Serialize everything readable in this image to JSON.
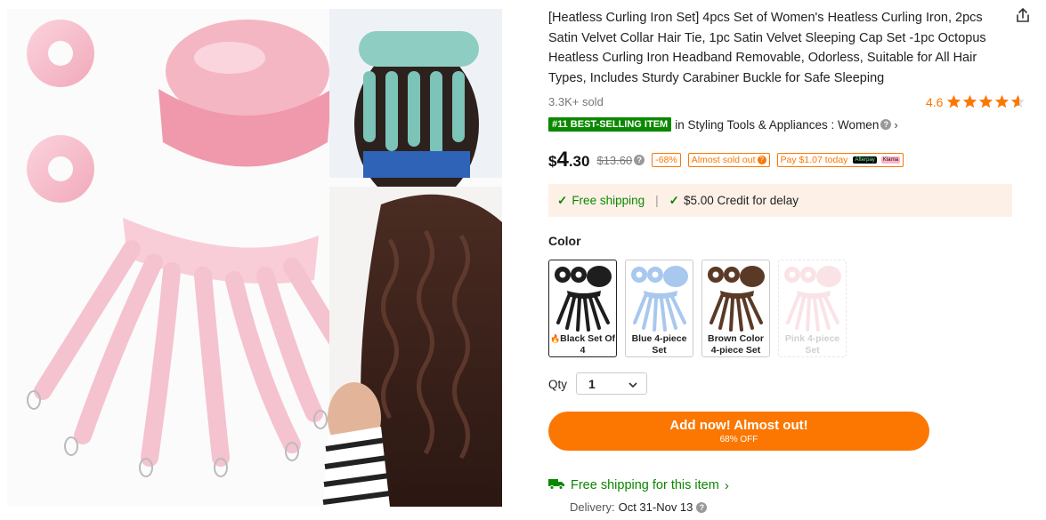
{
  "product": {
    "title": "[Heatless Curling Iron Set] 4pcs Set of Women's Heatless Curling Iron, 2pcs Satin Velvet Collar Hair Tie, 1pc Satin Velvet Sleeping Cap Set -1pc Octopus Heatless Curling Iron Headband Removable, Odorless, Suitable for All Hair Types, Includes Sturdy Carabiner Buckle for Safe Sleeping",
    "sold": "3.3K+ sold",
    "rating": "4.6",
    "rating_value": 4.6,
    "best_badge": "#11 BEST-SELLING ITEM",
    "best_category": "in Styling Tools & Appliances : Women"
  },
  "price": {
    "currency": "$",
    "integer": "4",
    "decimal": ".30",
    "original": "$13.60",
    "discount": "-68%",
    "almost_sold": "Almost sold out",
    "pay_today": "Pay $1.07 today",
    "pay_tag": "Afterpay",
    "klarna": "Klarna"
  },
  "shipping_box": {
    "free": "Free shipping",
    "separator": "|",
    "credit": "$5.00 Credit for delay"
  },
  "color": {
    "label": "Color",
    "options": [
      {
        "label": "Black Set Of 4",
        "hot": true,
        "selected": true,
        "color": "#1e1e1e"
      },
      {
        "label": "Blue 4-piece Set",
        "hot": false,
        "selected": false,
        "color": "#a8c8ee"
      },
      {
        "label": "Brown Color 4-piece Set",
        "hot": false,
        "selected": false,
        "color": "#5a3a26"
      },
      {
        "label": "Pink 4-piece Set",
        "hot": false,
        "selected": false,
        "disabled": true,
        "color": "#f4c2cc"
      }
    ]
  },
  "quantity": {
    "label": "Qty",
    "value": "1"
  },
  "cta": {
    "main": "Add now! Almost out!",
    "sub": "68% OFF"
  },
  "shipping": {
    "free_item": "Free shipping for this item"
  },
  "delivery": {
    "label": "Delivery:",
    "value": "Oct 31-Nov 13"
  },
  "icons": {
    "share": "share-icon",
    "star": "star-icon",
    "truck": "truck-icon",
    "check": "check-icon",
    "info": "info-icon",
    "chevron": "chevron-down-icon"
  },
  "colors": {
    "accent": "#fb7701",
    "green": "#0a8800",
    "ship_bg": "#fdf1e7"
  }
}
